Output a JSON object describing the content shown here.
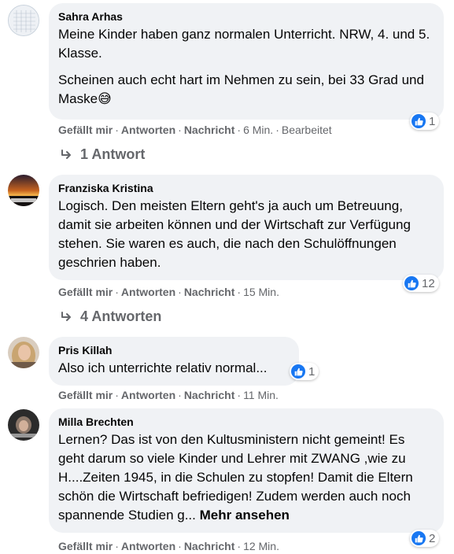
{
  "actions": {
    "like": "Gefällt mir",
    "reply": "Antworten",
    "message": "Nachricht",
    "separator": "·"
  },
  "comments": [
    {
      "author": "Sahra Arhas",
      "paragraphs": [
        "Meine Kinder haben ganz normalen Unterricht. NRW, 4. und 5. Klasse.",
        "Scheinen auch echt hart im Nehmen zu sein, bei 33 Grad und Maske😅"
      ],
      "time": "6 Min.",
      "edited": "Bearbeitet",
      "reactions": "1",
      "replies": "1 Antwort"
    },
    {
      "author": "Franziska Kristina",
      "paragraphs": [
        "Logisch. Den meisten Eltern geht's ja auch um Betreuung, damit sie arbeiten können und der Wirtschaft zur Verfügung stehen. Sie waren es auch, die nach den Schulöffnungen geschrien haben."
      ],
      "time": "15 Min.",
      "reactions": "12",
      "replies": "4 Antworten"
    },
    {
      "author": "Pris Killah",
      "paragraphs": [
        "Also ich unterrichte relativ normal..."
      ],
      "time": "11 Min.",
      "reactions": "1"
    },
    {
      "author": "Milla Brechten",
      "paragraphs": [
        "Lernen? Das ist von den Kultusministern nicht gemeint! Es geht darum so viele Kinder und Lehrer mit ZWANG ,wie zu H....Zeiten 1945, in die Schulen zu stopfen! Damit die Eltern schön die Wirtschaft befriedigen! Zudem werden auch noch spannende Studien g..."
      ],
      "see_more": "Mehr ansehen",
      "time": "12 Min.",
      "reactions": "2"
    }
  ],
  "colors": {
    "bubble": "#f0f2f5",
    "meta": "#65676b",
    "like_blue": "#1877f2"
  }
}
